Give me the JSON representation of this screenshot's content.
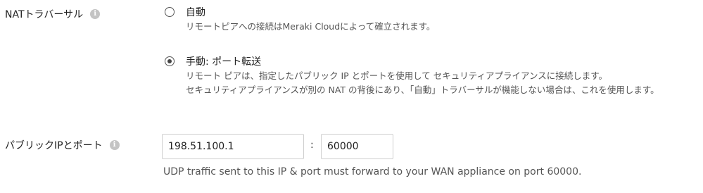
{
  "nat_traversal": {
    "label": "NATトラバーサル",
    "info_icon": "info-icon",
    "options": [
      {
        "title": "自動",
        "desc": [
          "リモートピアへの接続はMeraki Cloudによって確立されます。"
        ],
        "selected": false
      },
      {
        "title": "手動: ポート転送",
        "desc": [
          "リモート ピアは、指定したパブリック IP とポートを使用して セキュリティアプライアンスに接続します。",
          "セキュリティアプライアンスが別の NAT の背後にあり、「自動」トラバーサルが機能しない場合は、これを使用します。"
        ],
        "selected": true
      }
    ]
  },
  "public_ip_port": {
    "label": "パブリックIPとポート",
    "info_icon": "info-icon",
    "ip_value": "198.51.100.1",
    "separator": ":",
    "port_value": "60000",
    "help_text": "UDP traffic sent to this IP & port must forward to your WAN appliance on port 60000."
  }
}
